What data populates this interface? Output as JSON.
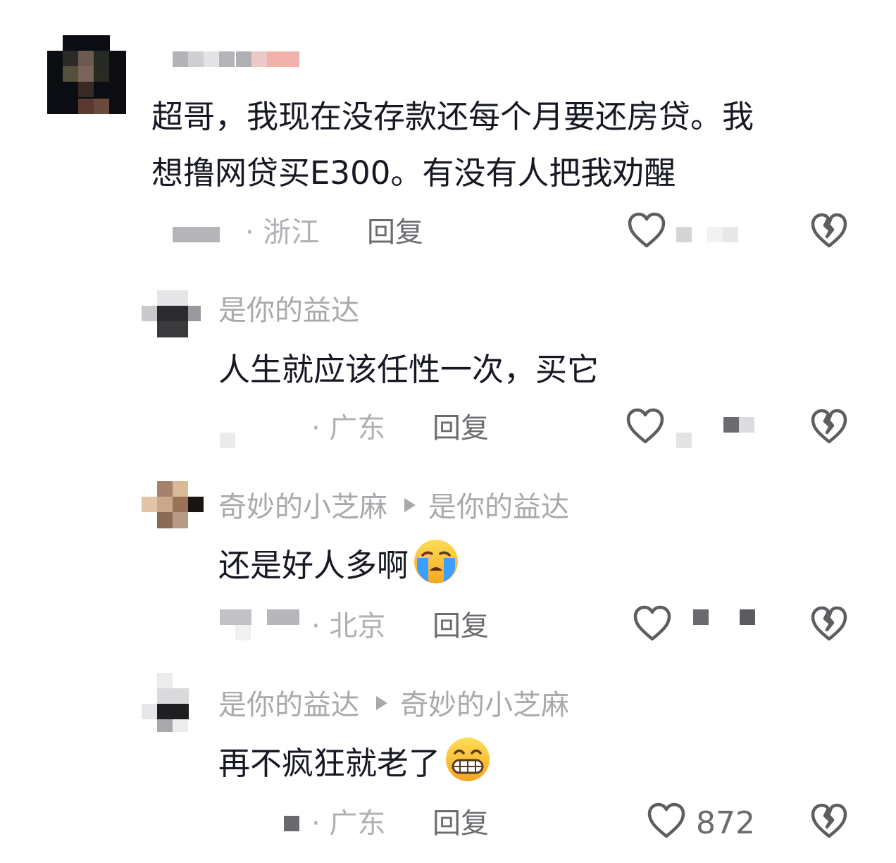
{
  "comments": [
    {
      "username": "",
      "content": "超哥，我现在没存款还每个月要还房贷。我\n想撸网贷买E300。有没有人把我劝醒",
      "location": "· 浙江",
      "reply_label": "回复",
      "like_count": ""
    },
    {
      "username": "是你的益达",
      "content": "人生就应该任性一次，买它",
      "location": "· 广东",
      "reply_label": "回复",
      "like_count": ""
    },
    {
      "username": "奇妙的小芝麻",
      "reply_to": "是你的益达",
      "content": "还是好人多啊",
      "emoji": "crying-face",
      "location": "· 北京",
      "reply_label": "回复",
      "like_count": ""
    },
    {
      "username": "是你的益达",
      "reply_to": "奇妙的小芝麻",
      "content": "再不疯狂就老了",
      "emoji": "grinning-face",
      "location": "· 广东",
      "reply_label": "回复",
      "like_count": "872"
    }
  ],
  "icons": {
    "like": "heart-outline-icon",
    "dislike": "broken-heart-icon",
    "reply_arrow": "triangle-right-icon"
  },
  "colors": {
    "text": "#161823",
    "username": "#a9a9ad",
    "meta": "#b0b0b5",
    "reply": "#6b6b70"
  }
}
